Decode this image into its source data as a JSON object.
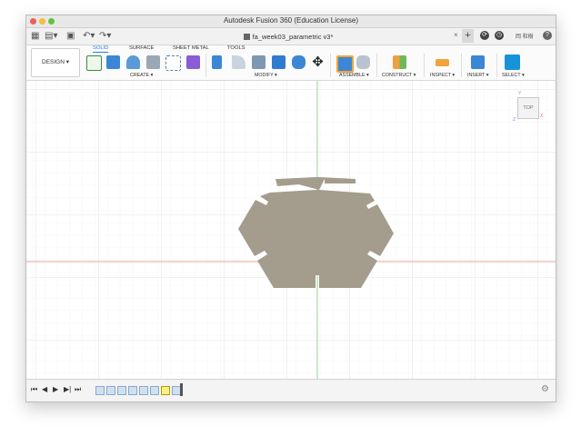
{
  "window": {
    "title": "Autodesk Fusion 360 (Education License)"
  },
  "tabbar": {
    "document_tab": "fa_week03_parametric v3*",
    "close": "×",
    "new_tab": "+",
    "user_initials": "岡 和樹"
  },
  "ribbon": {
    "workspace": "DESIGN ▾",
    "tabs": [
      "SOLID",
      "SURFACE",
      "SHEET METAL",
      "TOOLS"
    ],
    "groups": [
      "CREATE ▾",
      "MODIFY ▾",
      "ASSEMBLE ▾",
      "CONSTRUCT ▾",
      "INSPECT ▾",
      "INSERT ▾",
      "SELECT ▾"
    ],
    "accent": "#2b7bd9"
  },
  "viewport": {
    "viewcube_label": "TOP",
    "axis_labels": {
      "x": "X",
      "y": "Y",
      "z": "Z"
    },
    "shape_color": "#a49c8c",
    "x_axis_color": "#f0a39b",
    "y_axis_color": "#8fd68f"
  },
  "timeline": {
    "controls": [
      "⏮",
      "◀",
      "▶",
      "▶|",
      "⏭"
    ],
    "settings": "⚙"
  }
}
